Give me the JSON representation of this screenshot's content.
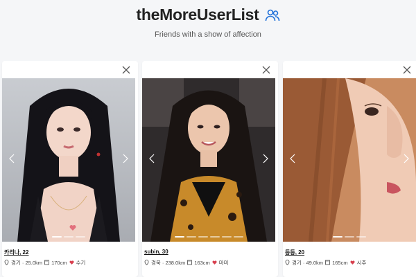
{
  "header": {
    "title": "theMoreUserList",
    "subtitle": "Friends with a show of affection",
    "icon": "users-icon",
    "accent": "#1e6fd9"
  },
  "cards": [
    {
      "name": "카리나, 22",
      "location": "경기 · 25.0km",
      "height": "170cm",
      "type": "수기",
      "photo_colors": {
        "bg": "#b9bdc4",
        "hair": "#15141a",
        "skin": "#f3d6c8",
        "cloth": "#1b1a1f"
      }
    },
    {
      "name": "subin, 30",
      "location": "경북 · 238.0km",
      "height": "163cm",
      "type": "마미",
      "photo_colors": {
        "bg": "#3a3535",
        "hair": "#1a1412",
        "skin": "#ecc6ad",
        "cloth": "#c88a2a"
      }
    },
    {
      "name": "등등, 20",
      "location": "경기 · 49.0km",
      "height": "165cm",
      "type": "시주",
      "photo_colors": {
        "bg": "#d5a07a",
        "hair": "#9a5a35",
        "skin": "#f0cbb5",
        "cloth": "#e8b89a"
      }
    }
  ],
  "icons": {
    "close": "close-icon",
    "prev": "chevron-left-icon",
    "next": "chevron-right-icon",
    "location": "map-pin-icon",
    "height": "ruler-icon",
    "type": "heart-icon"
  }
}
